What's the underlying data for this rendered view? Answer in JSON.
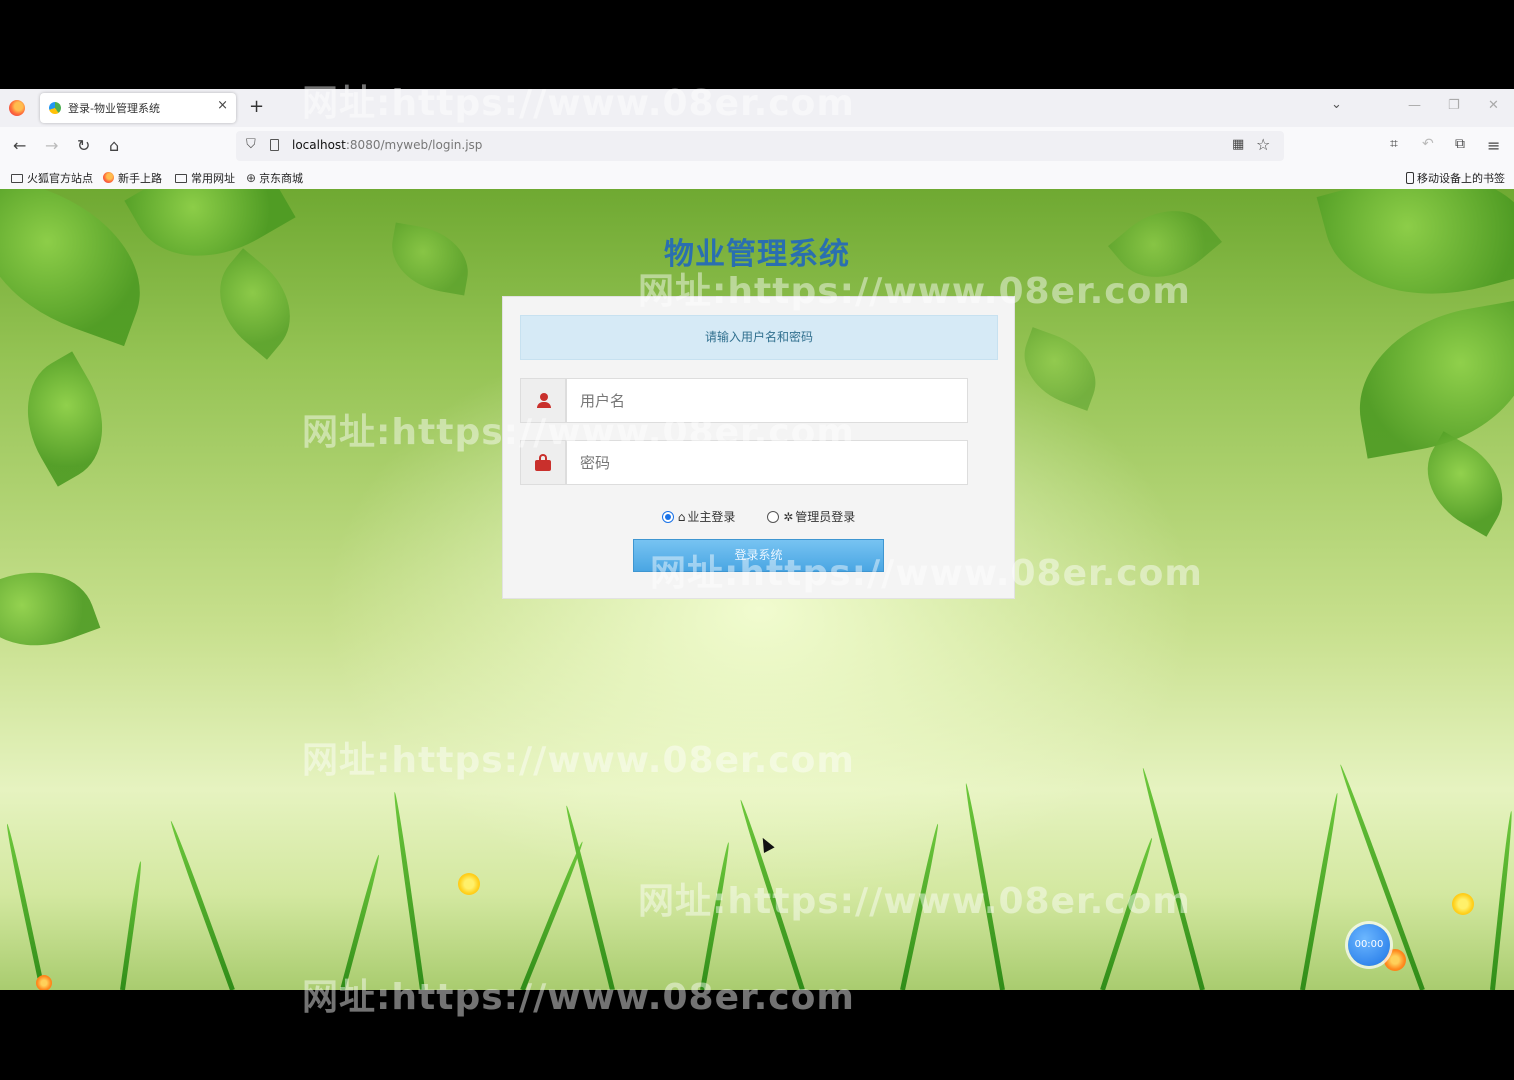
{
  "browser": {
    "tab_title": "登录-物业管理系统",
    "tab_close": "×",
    "new_tab": "+",
    "url_host": "localhost",
    "url_path": ":8080/myweb/login.jsp",
    "bookmarks": [
      "火狐官方站点",
      "新手上路",
      "常用网址",
      "京东商城"
    ],
    "mobile_bookmarks": "移动设备上的书签"
  },
  "page": {
    "title": "物业管理系统",
    "hint": "请输入用户名和密码",
    "username_placeholder": "用户名",
    "password_placeholder": "密码",
    "role_owner": "业主登录",
    "role_admin": "管理员登录",
    "selected_role": "业主登录",
    "login_button": "登录系统"
  },
  "timer": "00:00",
  "watermark": "网址:https://www.08er.com"
}
